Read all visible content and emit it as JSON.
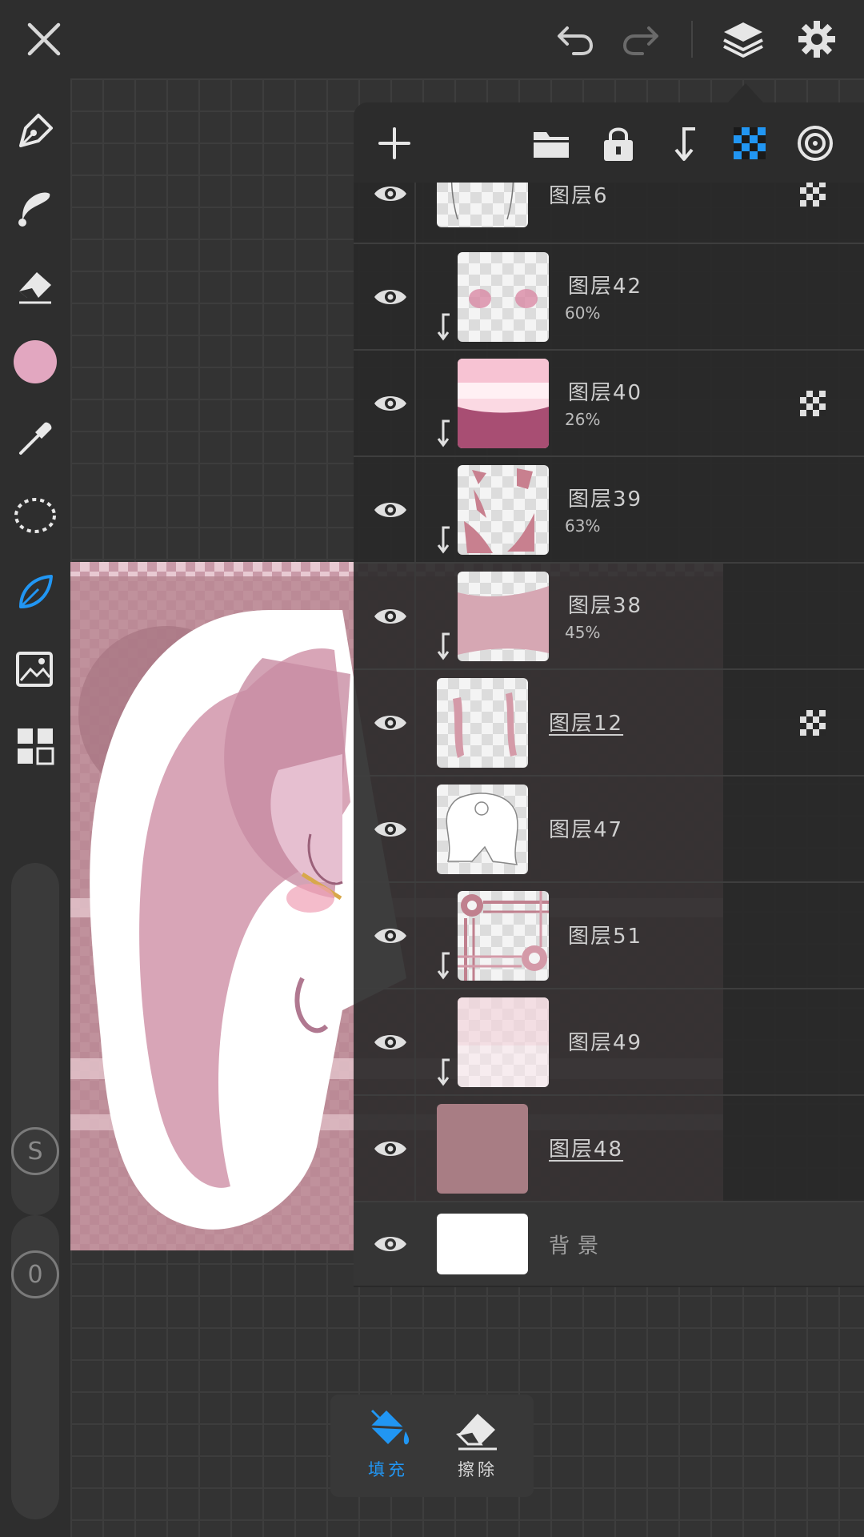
{
  "colors": {
    "accent": "#2196f3",
    "current_color": "#e2a7c0",
    "bg": "#2e2e2e"
  },
  "topbar": {
    "close_icon": "close-icon",
    "undo_icon": "undo-icon",
    "redo_icon": "redo-icon",
    "layers_icon": "layers-icon",
    "settings_icon": "gear-icon"
  },
  "left_tools": [
    "pen-icon",
    "smudge-icon",
    "eraser-icon",
    "color-swatch",
    "eyedropper-icon",
    "lasso-icon",
    "leaf-brush-icon",
    "image-import-icon",
    "grid-icon"
  ],
  "sliders": {
    "size_label": "S",
    "opacity_label": "0"
  },
  "layers_toolbar": [
    "add-layer-icon",
    "folder-icon",
    "lock-icon",
    "clip-icon",
    "alpha-lock-icon",
    "blend-icon"
  ],
  "layers": [
    {
      "name": "图层6",
      "opacity": "",
      "clipped": false,
      "alpha_lock": true
    },
    {
      "name": "图层42",
      "opacity": "60%",
      "clipped": true,
      "alpha_lock": false
    },
    {
      "name": "图层40",
      "opacity": "26%",
      "clipped": true,
      "alpha_lock": true
    },
    {
      "name": "图层39",
      "opacity": "63%",
      "clipped": true,
      "alpha_lock": false
    },
    {
      "name": "图层38",
      "opacity": "45%",
      "clipped": true,
      "alpha_lock": false
    },
    {
      "name": "图层12",
      "opacity": "",
      "clipped": false,
      "alpha_lock": true
    },
    {
      "name": "图层47",
      "opacity": "",
      "clipped": false,
      "alpha_lock": false
    },
    {
      "name": "图层51",
      "opacity": "",
      "clipped": true,
      "alpha_lock": false
    },
    {
      "name": "图层49",
      "opacity": "",
      "clipped": true,
      "alpha_lock": false
    },
    {
      "name": "图层48",
      "opacity": "",
      "clipped": false,
      "alpha_lock": false
    },
    {
      "name": "背景",
      "opacity": "",
      "clipped": false,
      "alpha_lock": false
    }
  ],
  "bottom_panel": {
    "fill_label": "填充",
    "erase_label": "擦除"
  }
}
